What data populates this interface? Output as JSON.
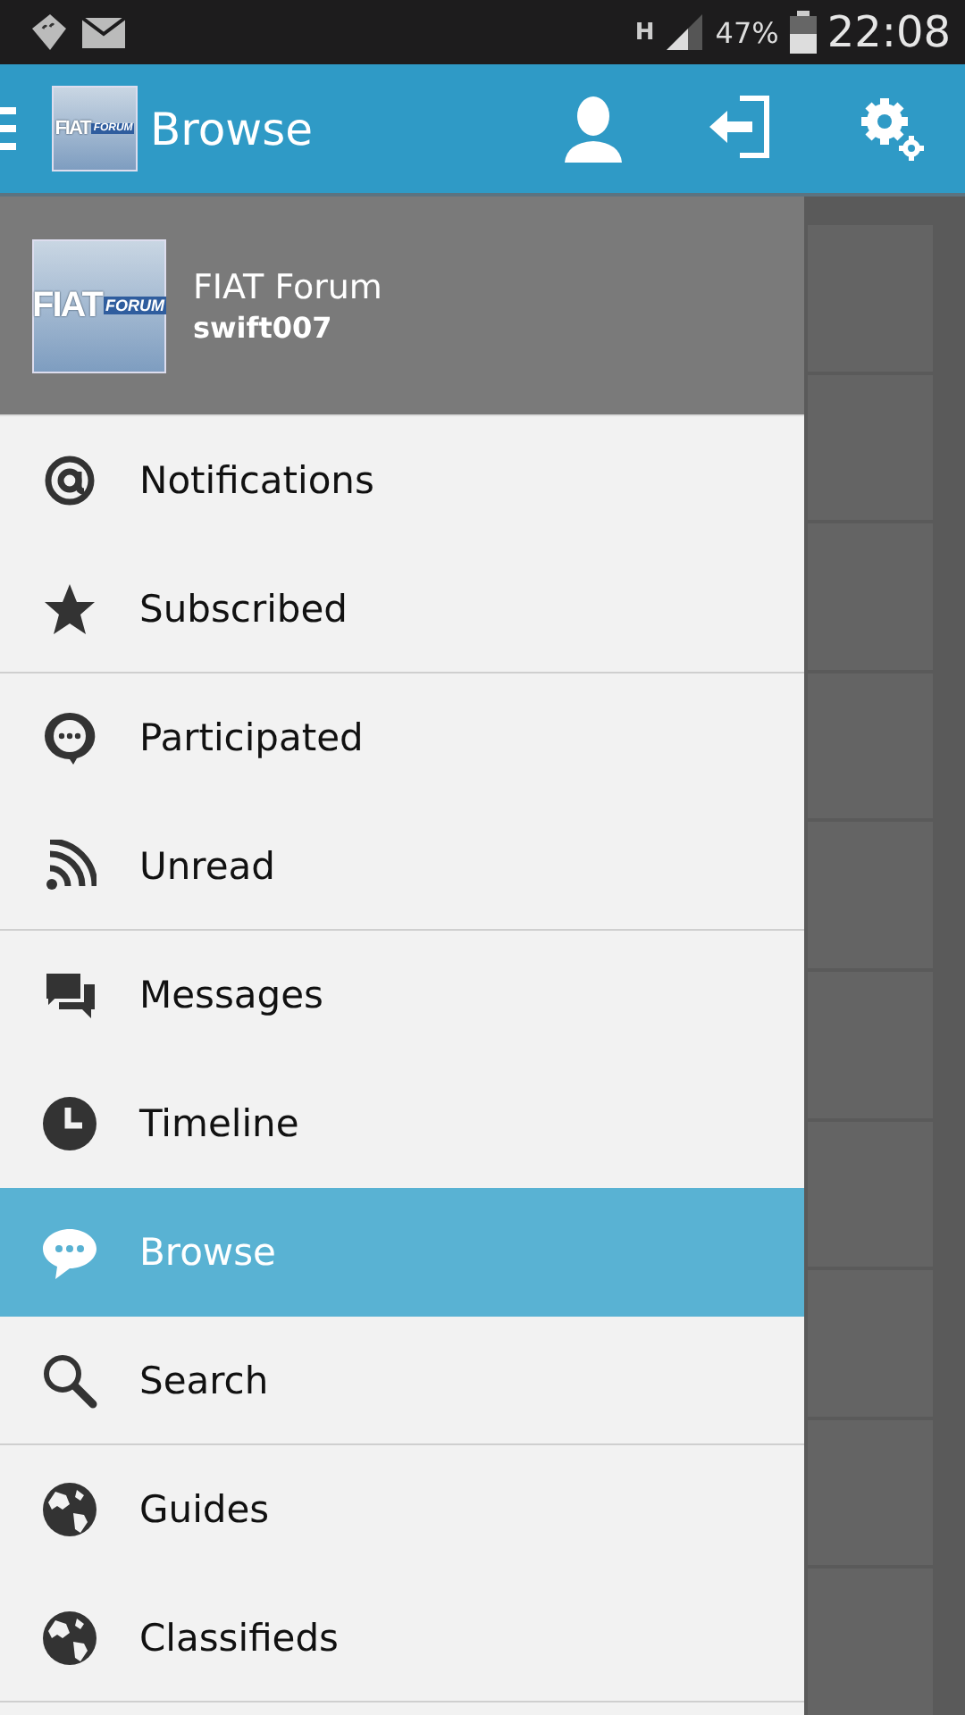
{
  "status_bar": {
    "network": "H",
    "battery": "47%",
    "time": "22:08"
  },
  "app_bar": {
    "logo": {
      "word": "FIAT",
      "badge": "FORUM"
    },
    "title": "Browse"
  },
  "drawer": {
    "header": {
      "logo": {
        "word": "FIAT",
        "badge": "FORUM"
      },
      "forum": "FIAT Forum",
      "user": "swift007"
    },
    "items": [
      {
        "label": "Notifications",
        "selected": false,
        "separated": false
      },
      {
        "label": "Subscribed",
        "selected": false,
        "separated": true
      },
      {
        "label": "Participated",
        "selected": false,
        "separated": false
      },
      {
        "label": "Unread",
        "selected": false,
        "separated": true
      },
      {
        "label": "Messages",
        "selected": false,
        "separated": false
      },
      {
        "label": "Timeline",
        "selected": false,
        "separated": false
      },
      {
        "label": "Browse",
        "selected": true,
        "separated": false
      },
      {
        "label": "Search",
        "selected": false,
        "separated": true
      },
      {
        "label": "Guides",
        "selected": false,
        "separated": false
      },
      {
        "label": "Classifieds",
        "selected": false,
        "separated": true
      }
    ]
  }
}
